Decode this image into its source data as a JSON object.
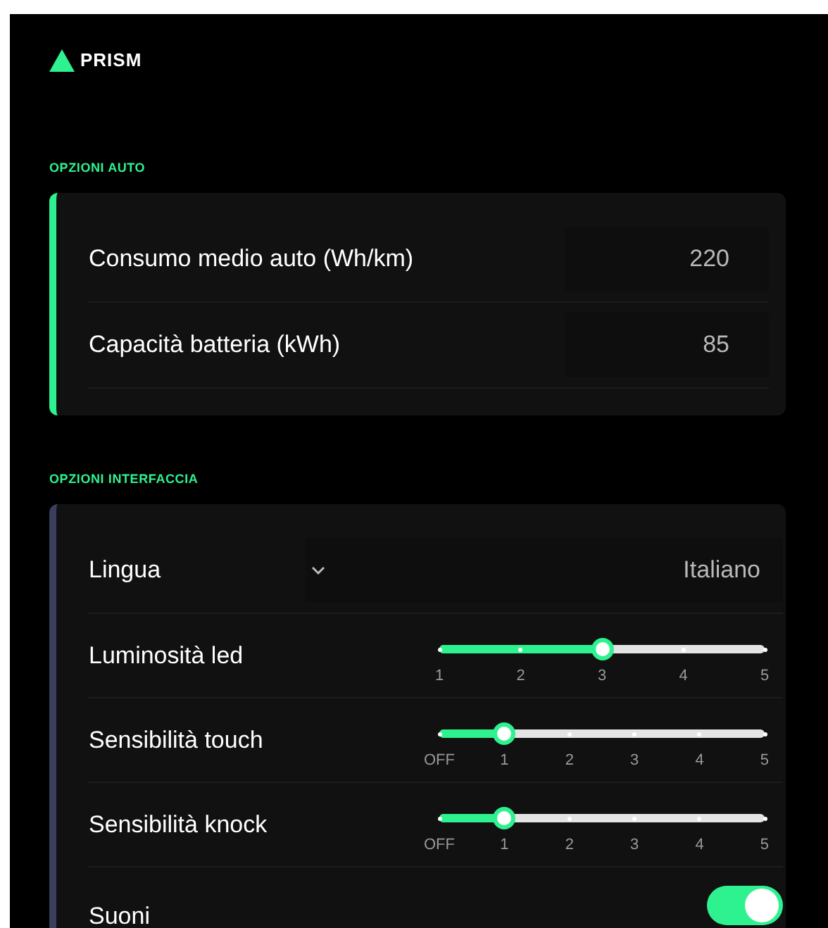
{
  "brand": {
    "name": "PRISM"
  },
  "sections": [
    {
      "title": "OPZIONI AUTO",
      "color": "#2ef28f",
      "rows": [
        {
          "kind": "input",
          "label": "Consumo medio auto (Wh/km)",
          "value": "220"
        },
        {
          "kind": "input",
          "label": "Capacità batteria (kWh)",
          "value": "85"
        }
      ]
    },
    {
      "title": "OPZIONI INTERFACCIA",
      "color": "#3b3f5e",
      "rows": [
        {
          "kind": "select",
          "label": "Lingua",
          "value": "Italiano"
        },
        {
          "kind": "slider",
          "label": "Luminosità led",
          "level": 0.5,
          "ticks": [
            "1",
            "2",
            "3",
            "4",
            "5"
          ]
        },
        {
          "kind": "slider",
          "label": "Sensibilità touch",
          "level": 0.2,
          "ticks": [
            "OFF",
            "1",
            "2",
            "3",
            "4",
            "5"
          ]
        },
        {
          "kind": "slider",
          "label": "Sensibilità knock",
          "level": 0.2,
          "ticks": [
            "OFF",
            "1",
            "2",
            "3",
            "4",
            "5"
          ]
        },
        {
          "kind": "toggle",
          "label": "Suoni",
          "on": true
        }
      ]
    }
  ]
}
